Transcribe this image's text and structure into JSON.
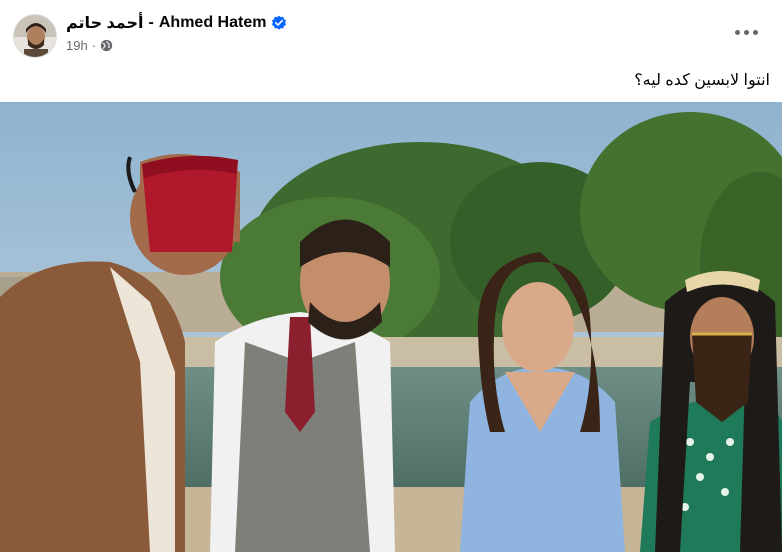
{
  "post": {
    "author_arabic": "أحمد حاتم",
    "author_separator": "-",
    "author_latin": "Ahmed Hatem",
    "verified_icon": "verified-badge-icon",
    "timestamp": "19h",
    "meta_separator": "·",
    "privacy_icon": "globe-icon",
    "more_icon": "more-options-icon",
    "caption": "انتوا لابسين كده ليه؟"
  },
  "colors": {
    "verified_blue": "#0866ff",
    "meta_gray": "#65676b",
    "text": "#050505"
  }
}
